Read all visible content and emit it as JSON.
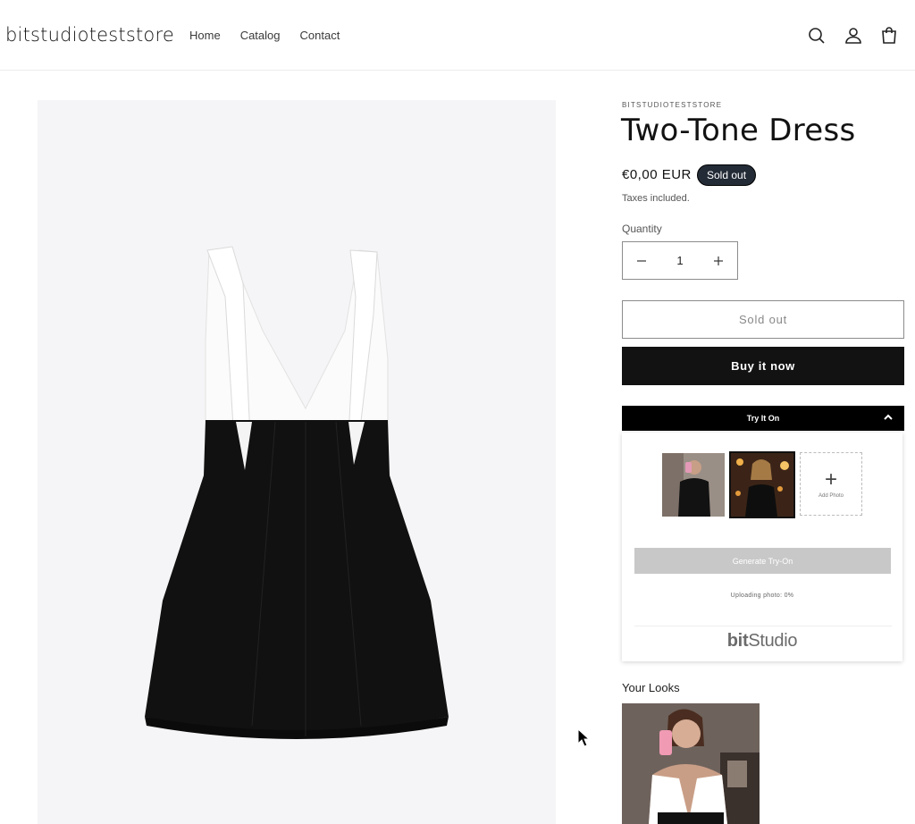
{
  "header": {
    "logo": "bitstudioteststore",
    "nav": [
      "Home",
      "Catalog",
      "Contact"
    ],
    "icons": [
      "search-icon",
      "account-icon",
      "cart-icon"
    ]
  },
  "product": {
    "vendor": "BITSTUDIOTESTSTORE",
    "title": "Two-Tone Dress",
    "price": "€0,00 EUR",
    "badge": "Sold out",
    "taxes": "Taxes included.",
    "quantity_label": "Quantity",
    "quantity": "1",
    "soldout_button": "Sold out",
    "buy_button": "Buy it now"
  },
  "tryon": {
    "header": "Try It On",
    "add_photo": "Add Photo",
    "generate_button": "Generate Try-On",
    "upload_status": "Uploading photo: 0%",
    "brand_bold": "bit",
    "brand_rest": "Studio"
  },
  "looks": {
    "title": "Your Looks"
  },
  "colors": {
    "badge_bg": "#232b36",
    "buy_bg": "#121212",
    "tryon_head_bg": "#000000",
    "generate_disabled": "#c8c8c8",
    "media_bg": "#f5f5f7"
  }
}
